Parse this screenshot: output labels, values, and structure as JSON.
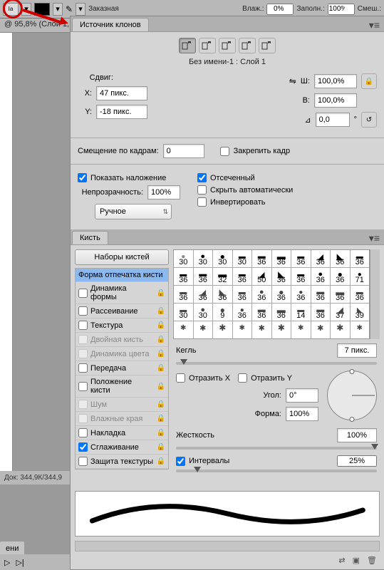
{
  "topbar": {
    "style_label": "Заказная",
    "vlazh_label": "Влаж.:",
    "vlazh_value": "0%",
    "zapoln_label": "Заполн.:",
    "zapoln_value": "100%",
    "smesh_label": "Смеш.:"
  },
  "zoom": "@ 95,8% (Слой 1,",
  "clonePanel": {
    "tab": "Источник клонов",
    "layer_label": "Без имени-1 : Слой 1",
    "sdvig_label": "Сдвиг:",
    "x_label": "X:",
    "x_value": "47 пикс.",
    "y_label": "Y:",
    "y_value": "-18 пикс.",
    "w_label": "Ш:",
    "w_value": "100,0%",
    "h_label": "В:",
    "h_value": "100,0%",
    "angle_value": "0,0",
    "angle_unit": "°",
    "offset_label": "Смещение по кадрам:",
    "offset_value": "0",
    "lock_frame": "Закрепить кадр",
    "show_overlay": "Показать наложение",
    "opacity_label": "Непрозрачность:",
    "opacity_value": "100%",
    "clipped": "Отсеченный",
    "auto_hide": "Скрыть автоматически",
    "invert": "Инвертировать",
    "mode_select": "Ручное"
  },
  "brushPanel": {
    "tab": "Кисть",
    "presets_btn": "Наборы кистей",
    "options": [
      {
        "label": "Форма отпечатка кисти",
        "selected": true,
        "checkbox": false
      },
      {
        "label": "Динамика формы",
        "lock": true,
        "checkbox": true
      },
      {
        "label": "Рассеивание",
        "lock": true,
        "checkbox": true
      },
      {
        "label": "Текстура",
        "lock": true,
        "checkbox": true
      },
      {
        "label": "Двойная кисть",
        "lock": true,
        "disabled": true,
        "checkbox": true
      },
      {
        "label": "Динамика цвета",
        "lock": true,
        "disabled": true,
        "checkbox": true
      },
      {
        "label": "Передача",
        "lock": true,
        "checkbox": true
      },
      {
        "label": "Положение кисти",
        "lock": true,
        "checkbox": true
      },
      {
        "label": "Шум",
        "lock": true,
        "disabled": true,
        "checkbox": true
      },
      {
        "label": "Влажные края",
        "lock": true,
        "disabled": true,
        "checkbox": true
      },
      {
        "label": "Накладка",
        "lock": true,
        "checkbox": true
      },
      {
        "label": "Сглаживание",
        "lock": true,
        "checked": true,
        "checkbox": true
      },
      {
        "label": "Защита текстуры",
        "lock": true,
        "checkbox": true
      }
    ],
    "brushGrid": [
      [
        30,
        30,
        30,
        30,
        36,
        36,
        36,
        36,
        36,
        36
      ],
      [
        36,
        36,
        32,
        36,
        50,
        36,
        36,
        36,
        36,
        71
      ],
      [
        36,
        36,
        36,
        36,
        36,
        36,
        36,
        36,
        36,
        36
      ],
      [
        30,
        30,
        9,
        36,
        36,
        36,
        14,
        36,
        37,
        39
      ],
      [
        "",
        "",
        "",
        "",
        "",
        "",
        "",
        "",
        "",
        ""
      ]
    ],
    "kegel_label": "Кегль",
    "kegel_value": "7 пикс.",
    "flip_x": "Отразить X",
    "flip_y": "Отразить Y",
    "angle_label": "Угол:",
    "angle_value": "0°",
    "shape_label": "Форма:",
    "shape_value": "100%",
    "hardness_label": "Жесткость",
    "hardness_value": "100%",
    "spacing_label": "Интервалы",
    "spacing_value": "25%"
  },
  "docInfo": "Док: 344,9К/344,9",
  "bottomTab": "ени"
}
